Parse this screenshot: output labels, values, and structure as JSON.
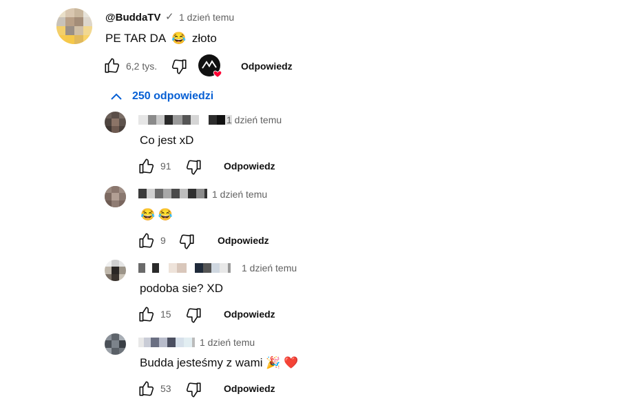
{
  "main_comment": {
    "author": "@BuddaTV",
    "verified_mark": "✓",
    "time": "1 dzień temu",
    "text_before": "PE TAR DA",
    "emoji": "😂",
    "text_after": "złoto",
    "likes": "6,2 tys.",
    "reply_label": "Odpowiedz",
    "creator_heart_color": "#ff0033"
  },
  "replies_toggle": {
    "label": "250 odpowiedzi",
    "icon": "chevron-up-icon",
    "color": "#065fd4"
  },
  "replies": [
    {
      "time": "1 dzień temu",
      "text": "Co jest xD",
      "likes": "91",
      "reply_label": "Odpowiedz"
    },
    {
      "time": "1 dzień temu",
      "text": "😂 😂",
      "likes": "9",
      "reply_label": "Odpowiedz"
    },
    {
      "time": "1 dzień temu",
      "text": "podoba sie? XD",
      "likes": "15",
      "reply_label": "Odpowiedz"
    },
    {
      "time": "1 dzień temu",
      "text": "Budda jesteśmy z wami 🎉 ❤️",
      "likes": "53",
      "reply_label": "Odpowiedz"
    }
  ]
}
